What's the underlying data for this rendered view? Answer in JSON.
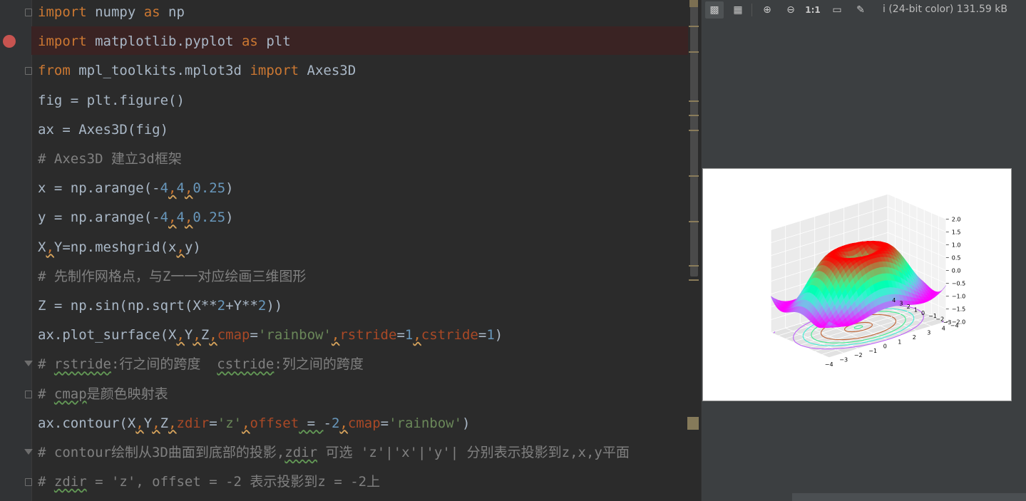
{
  "editor": {
    "lines": [
      {
        "tokens": [
          {
            "t": "import",
            "c": "kw"
          },
          {
            "t": " numpy "
          },
          {
            "t": "as",
            "c": "kw"
          },
          {
            "t": " np"
          }
        ]
      },
      {
        "tokens": [
          {
            "t": "import",
            "c": "kw"
          },
          {
            "t": " matplotlib.pyplot "
          },
          {
            "t": "as",
            "c": "kw"
          },
          {
            "t": " plt"
          }
        ]
      },
      {
        "tokens": [
          {
            "t": "from",
            "c": "kw"
          },
          {
            "t": " mpl_toolkits.mplot3d "
          },
          {
            "t": "import",
            "c": "kw"
          },
          {
            "t": " Axes3D"
          }
        ]
      },
      {
        "tokens": [
          {
            "t": "fig = plt.figure()"
          }
        ]
      },
      {
        "tokens": [
          {
            "t": "ax = Axes3D(fig)"
          }
        ]
      },
      {
        "tokens": [
          {
            "t": "# Axes3D 建立3d框架",
            "c": "cmt"
          }
        ]
      },
      {
        "tokens": [
          {
            "t": "x = np.arange(-"
          },
          {
            "t": "4",
            "c": "num"
          },
          {
            "t": ",",
            "c": "sep"
          },
          {
            "t": "4",
            "c": "num"
          },
          {
            "t": ",",
            "c": "sep"
          },
          {
            "t": "0.25",
            "c": "num"
          },
          {
            "t": ")"
          }
        ]
      },
      {
        "tokens": [
          {
            "t": "y = np.arange(-"
          },
          {
            "t": "4",
            "c": "num"
          },
          {
            "t": ",",
            "c": "sep"
          },
          {
            "t": "4",
            "c": "num"
          },
          {
            "t": ",",
            "c": "sep"
          },
          {
            "t": "0.25",
            "c": "num"
          },
          {
            "t": ")"
          }
        ]
      },
      {
        "tokens": [
          {
            "t": "X"
          },
          {
            "t": ",",
            "c": "sep"
          },
          {
            "t": "Y=np.meshgrid(x"
          },
          {
            "t": ",",
            "c": "sep"
          },
          {
            "t": "y)"
          }
        ]
      },
      {
        "tokens": [
          {
            "t": "# 先制作网格点，与Z一一对应绘画三维图形",
            "c": "cmt"
          }
        ]
      },
      {
        "tokens": [
          {
            "t": "Z = np.sin(np.sqrt(X**"
          },
          {
            "t": "2",
            "c": "num"
          },
          {
            "t": "+Y**"
          },
          {
            "t": "2",
            "c": "num"
          },
          {
            "t": "))"
          }
        ]
      },
      {
        "tokens": [
          {
            "t": "ax.plot_surface(X"
          },
          {
            "t": ",",
            "c": "sep"
          },
          {
            "t": "Y"
          },
          {
            "t": ",",
            "c": "sep"
          },
          {
            "t": "Z"
          },
          {
            "t": ",",
            "c": "sep"
          },
          {
            "t": "cmap",
            "c": "par"
          },
          {
            "t": "="
          },
          {
            "t": "'rainbow'",
            "c": "str"
          },
          {
            "t": ",",
            "c": "sep"
          },
          {
            "t": "rstride",
            "c": "par"
          },
          {
            "t": "="
          },
          {
            "t": "1",
            "c": "num"
          },
          {
            "t": ",",
            "c": "sep"
          },
          {
            "t": "cstride",
            "c": "par"
          },
          {
            "t": "="
          },
          {
            "t": "1",
            "c": "num"
          },
          {
            "t": ")"
          }
        ]
      },
      {
        "tokens": [
          {
            "t": "# ",
            "c": "cmt"
          },
          {
            "t": "rstride",
            "c": "cmt wv"
          },
          {
            "t": ":行之间的跨度  ",
            "c": "cmt"
          },
          {
            "t": "cstride",
            "c": "cmt wv"
          },
          {
            "t": ":列之间的跨度",
            "c": "cmt"
          }
        ]
      },
      {
        "tokens": [
          {
            "t": "# ",
            "c": "cmt"
          },
          {
            "t": "cmap",
            "c": "cmt wv"
          },
          {
            "t": "是颜色映射表",
            "c": "cmt"
          }
        ]
      },
      {
        "tokens": [
          {
            "t": "ax.contour(X"
          },
          {
            "t": ",",
            "c": "sep"
          },
          {
            "t": "Y"
          },
          {
            "t": ",",
            "c": "sep"
          },
          {
            "t": "Z"
          },
          {
            "t": ",",
            "c": "sep"
          },
          {
            "t": "zdir",
            "c": "par"
          },
          {
            "t": "="
          },
          {
            "t": "'z'",
            "c": "str"
          },
          {
            "t": ",",
            "c": "sep"
          },
          {
            "t": "offset",
            "c": "par"
          },
          {
            "t": " = ",
            "c": "wv"
          },
          {
            "t": "-"
          },
          {
            "t": "2",
            "c": "num"
          },
          {
            "t": ",",
            "c": "sep"
          },
          {
            "t": "cmap",
            "c": "par"
          },
          {
            "t": "="
          },
          {
            "t": "'rainbow'",
            "c": "str"
          },
          {
            "t": ")"
          }
        ]
      },
      {
        "tokens": [
          {
            "t": "# contour绘制从3D曲面到底部的投影,",
            "c": "cmt"
          },
          {
            "t": "zdir",
            "c": "cmt wv"
          },
          {
            "t": " 可选 'z'|'x'|'y'| 分别表示投影到z,x,y平面",
            "c": "cmt"
          }
        ]
      },
      {
        "tokens": [
          {
            "t": "# ",
            "c": "cmt"
          },
          {
            "t": "zdir",
            "c": "cmt wv"
          },
          {
            "t": " = 'z', offset = -2 表示投影到z = -2上",
            "c": "cmt"
          }
        ]
      }
    ]
  },
  "viewer": {
    "toolbar": [
      {
        "name": "transparency-chessboard-icon",
        "glyph": "▩",
        "active": true
      },
      {
        "name": "grid-icon",
        "glyph": "▦",
        "active": false
      },
      {
        "name": "zoom-in-icon",
        "glyph": "⊕",
        "active": false
      },
      {
        "name": "zoom-out-icon",
        "glyph": "⊖",
        "active": false
      },
      {
        "name": "actual-size-icon",
        "glyph": "1:1",
        "active": false
      },
      {
        "name": "fit-zoom-icon",
        "glyph": "▭",
        "active": false
      },
      {
        "name": "color-picker-icon",
        "glyph": "✎",
        "active": false
      }
    ],
    "info": "i (24-bit color) 131.59 kB"
  },
  "chart_data": {
    "type": "surface3d",
    "title": "",
    "colormap": "rainbow",
    "function": "z = sin(sqrt(x^2 + y^2))",
    "x_range": [
      -4,
      4
    ],
    "y_range": [
      -4,
      4
    ],
    "step": 0.25,
    "z_axis": {
      "ticks": [
        "2.0",
        "1.5",
        "1.0",
        "0.5",
        "0.0",
        "-0.5",
        "-1.0",
        "-1.5",
        "-2.0"
      ],
      "range": [
        -2,
        2
      ]
    },
    "x_axis": {
      "ticks": [
        "-4",
        "-3",
        "-2",
        "-1",
        "0",
        "1",
        "2",
        "3",
        "4"
      ]
    },
    "y_axis": {
      "ticks": [
        "-4",
        "-3",
        "-2",
        "-1",
        "0",
        "1",
        "2",
        "3",
        "4"
      ]
    },
    "contour": {
      "zdir": "z",
      "offset": -2
    },
    "grid": true
  }
}
